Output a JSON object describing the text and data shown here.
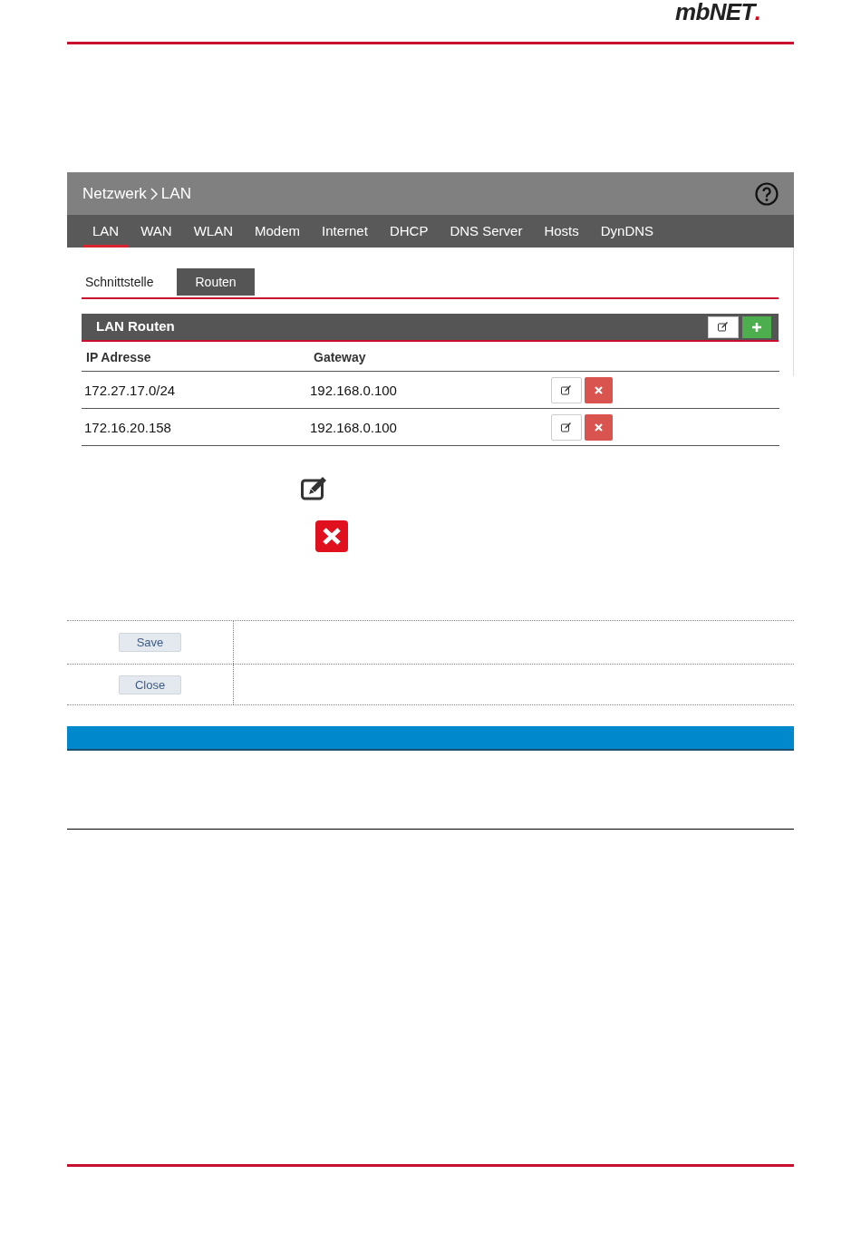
{
  "logo": {
    "text": "mbNET",
    "dot": "."
  },
  "panel": {
    "breadcrumb": [
      "Netzwerk",
      "LAN"
    ],
    "nav_tabs": [
      {
        "label": "LAN",
        "selected": true
      },
      {
        "label": "WAN",
        "selected": false
      },
      {
        "label": "WLAN",
        "selected": false
      },
      {
        "label": "Modem",
        "selected": false
      },
      {
        "label": "Internet",
        "selected": false
      },
      {
        "label": "DHCP",
        "selected": false
      },
      {
        "label": "DNS Server",
        "selected": false
      },
      {
        "label": "Hosts",
        "selected": false
      },
      {
        "label": "DynDNS",
        "selected": false
      }
    ],
    "sub_tabs": [
      {
        "label": "Schnittstelle",
        "selected": false
      },
      {
        "label": "Routen",
        "selected": true
      }
    ],
    "section_title": "LAN Routen",
    "table": {
      "columns": [
        "IP Adresse",
        "Gateway"
      ],
      "rows": [
        {
          "ip": "172.27.17.0/24",
          "gateway": "192.168.0.100"
        },
        {
          "ip": "172.16.20.158",
          "gateway": "192.168.0.100"
        }
      ]
    }
  },
  "buttons": [
    "Save",
    "Close"
  ]
}
